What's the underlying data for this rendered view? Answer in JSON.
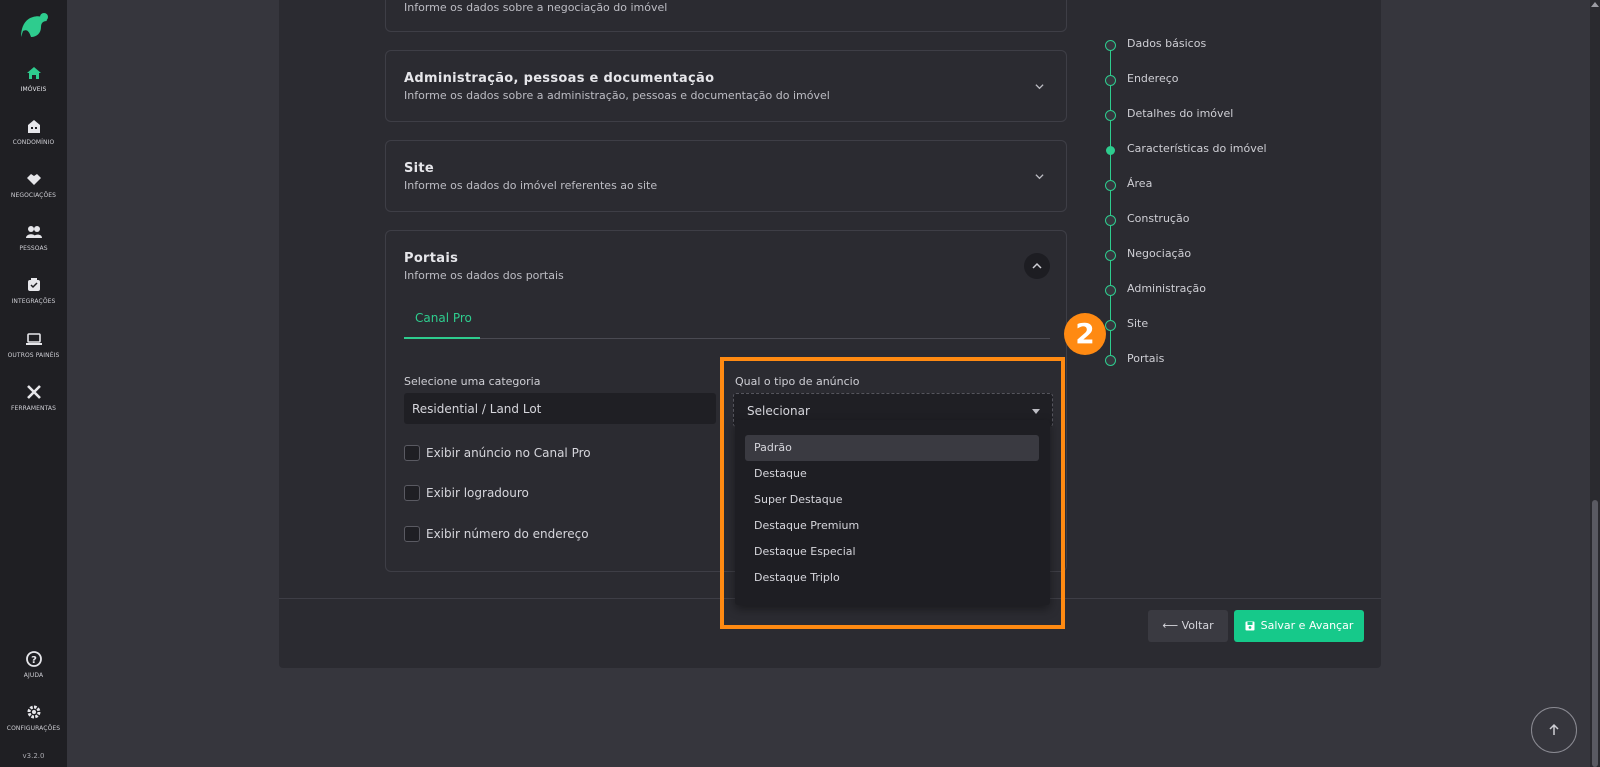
{
  "sidebar": {
    "items": [
      {
        "label": "IMÓVEIS",
        "icon": "home-icon"
      },
      {
        "label": "CONDOMÍNIO",
        "icon": "building-icon"
      },
      {
        "label": "NEGOCIAÇÕES",
        "icon": "handshake-icon"
      },
      {
        "label": "PESSOAS",
        "icon": "people-icon"
      },
      {
        "label": "INTEGRAÇÕES",
        "icon": "integration-icon"
      },
      {
        "label": "OUTROS PAINÉIS",
        "icon": "laptop-icon"
      },
      {
        "label": "FERRAMENTAS",
        "icon": "tools-icon"
      }
    ],
    "bottom": [
      {
        "label": "AJUDA",
        "icon": "help-icon"
      },
      {
        "label": "CONFIGURAÇÕES",
        "icon": "gear-icon"
      }
    ],
    "version": "v3.2.0"
  },
  "sections": {
    "negociacao_sub": "Informe os dados sobre a negociação do imóvel",
    "administracao": {
      "title": "Administração, pessoas e documentação",
      "subtitle": "Informe os dados sobre a administração, pessoas e documentação do imóvel"
    },
    "site": {
      "title": "Site",
      "subtitle": "Informe os dados do imóvel referentes ao site"
    },
    "portais": {
      "title": "Portais",
      "subtitle": "Informe os dados dos portais"
    }
  },
  "portais": {
    "tab": "Canal Pro",
    "categoria_label": "Selecione uma categoria",
    "categoria_value": "Residential / Land Lot",
    "tipo_label": "Qual o tipo de anúncio",
    "tipo_value": "Selecionar",
    "checkboxes": [
      "Exibir anúncio no Canal Pro",
      "Exibir logradouro",
      "Exibir número do endereço"
    ],
    "options": [
      "Padrão",
      "Destaque",
      "Super Destaque",
      "Destaque Premium",
      "Destaque Especial",
      "Destaque Triplo"
    ]
  },
  "footer": {
    "back_label": "Voltar",
    "save_label": "Salvar e Avançar"
  },
  "stepper": [
    "Dados básicos",
    "Endereço",
    "Detalhes do imóvel",
    "Características do imóvel",
    "Área",
    "Construção",
    "Negociação",
    "Administração",
    "Site",
    "Portais"
  ],
  "annotation": {
    "step": "2"
  },
  "colors": {
    "accent": "#16c98a",
    "highlight": "#ff8a12"
  }
}
